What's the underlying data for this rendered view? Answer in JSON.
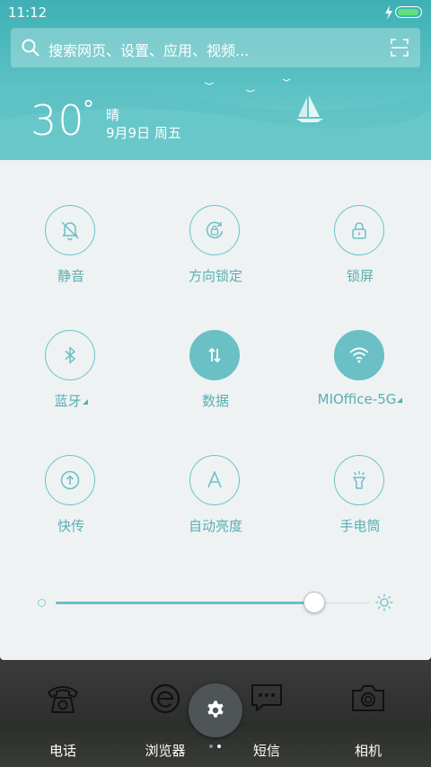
{
  "status_bar": {
    "time": "11:12",
    "battery_level": 1.0
  },
  "search": {
    "placeholder": "搜索网页、设置、应用、视频..."
  },
  "weather": {
    "temperature": "30",
    "unit": "°",
    "condition": "晴",
    "date": "9月9日 周五"
  },
  "toggles": [
    {
      "label": "静音",
      "icon": "bell-off-icon",
      "active": false,
      "has_menu": false
    },
    {
      "label": "方向锁定",
      "icon": "rotation-lock-icon",
      "active": false,
      "has_menu": false
    },
    {
      "label": "锁屏",
      "icon": "lock-icon",
      "active": false,
      "has_menu": false
    },
    {
      "label": "蓝牙",
      "icon": "bluetooth-icon",
      "active": false,
      "has_menu": true
    },
    {
      "label": "数据",
      "icon": "data-arrows-icon",
      "active": true,
      "has_menu": false
    },
    {
      "label": "MIOffice-5G",
      "icon": "wifi-icon",
      "active": true,
      "has_menu": true
    },
    {
      "label": "快传",
      "icon": "share-upload-icon",
      "active": false,
      "has_menu": false
    },
    {
      "label": "自动亮度",
      "icon": "auto-brightness-icon",
      "active": false,
      "has_menu": false
    },
    {
      "label": "手电筒",
      "icon": "flashlight-icon",
      "active": false,
      "has_menu": false
    }
  ],
  "brightness": {
    "level": 0.82
  },
  "dock": {
    "apps": [
      {
        "label": "电话",
        "icon": "phone-icon"
      },
      {
        "label": "浏览器",
        "icon": "browser-icon"
      },
      {
        "label": "短信",
        "icon": "message-icon"
      },
      {
        "label": "相机",
        "icon": "camera-icon"
      }
    ],
    "settings_icon": "gear-icon",
    "page_count": 2,
    "current_page": 2
  },
  "colors": {
    "accent": "#6ac0c4",
    "header_top": "#3fb0b5",
    "panel_bg": "#eef2f3"
  }
}
